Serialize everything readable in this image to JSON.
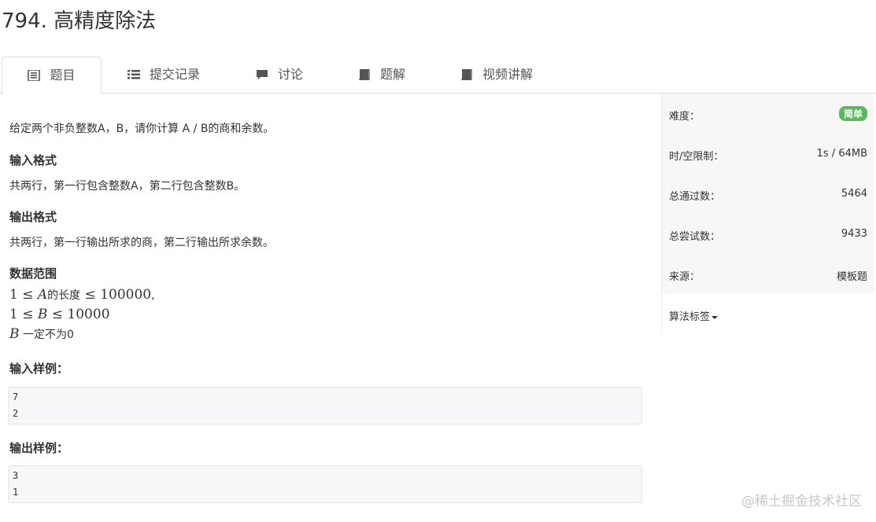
{
  "problem": {
    "title": "794. 高精度除法"
  },
  "tabs": [
    {
      "label": "题目",
      "icon": "document-icon",
      "active": true
    },
    {
      "label": "提交记录",
      "icon": "list-icon"
    },
    {
      "label": "讨论",
      "icon": "comment-icon"
    },
    {
      "label": "题解",
      "icon": "book-icon"
    },
    {
      "label": "视频讲解",
      "icon": "book-icon"
    }
  ],
  "content": {
    "intro": "给定两个非负整数A，B，请你计算 A / B的商和余数。",
    "input_format_heading": "输入格式",
    "input_format_text": "共两行，第一行包含整数A，第二行包含整数B。",
    "output_format_heading": "输出格式",
    "output_format_text": "共两行，第一行输出所求的商，第二行输出所求余数。",
    "range_heading": "数据范围",
    "range_line1_pre": "1 ≤ ",
    "range_line1_var": "A",
    "range_line1_mid": "的长度",
    "range_line1_post": " ≤ 100000",
    "range_line1_end": ",",
    "range_line2_pre": "1 ≤ ",
    "range_line2_var": "B",
    "range_line2_post": " ≤ 10000",
    "range_line3_var": "B",
    "range_line3_text": " 一定不为0",
    "sample_input_heading": "输入样例：",
    "sample_input_lines": [
      "7",
      "2"
    ],
    "sample_output_heading": "输出样例：",
    "sample_output_lines": [
      "3",
      "1"
    ]
  },
  "sidebar": {
    "difficulty_label": "难度：",
    "difficulty_value": "简单",
    "difficulty_color": "#5cb85c",
    "limit_label": "时/空限制：",
    "limit_value": "1s / 64MB",
    "passed_label": "总通过数：",
    "passed_value": "5464",
    "attempts_label": "总尝试数：",
    "attempts_value": "9433",
    "source_label": "来源：",
    "source_value": "模板题",
    "tags_label": "算法标签"
  },
  "watermark": "@稀土掘金技术社区"
}
